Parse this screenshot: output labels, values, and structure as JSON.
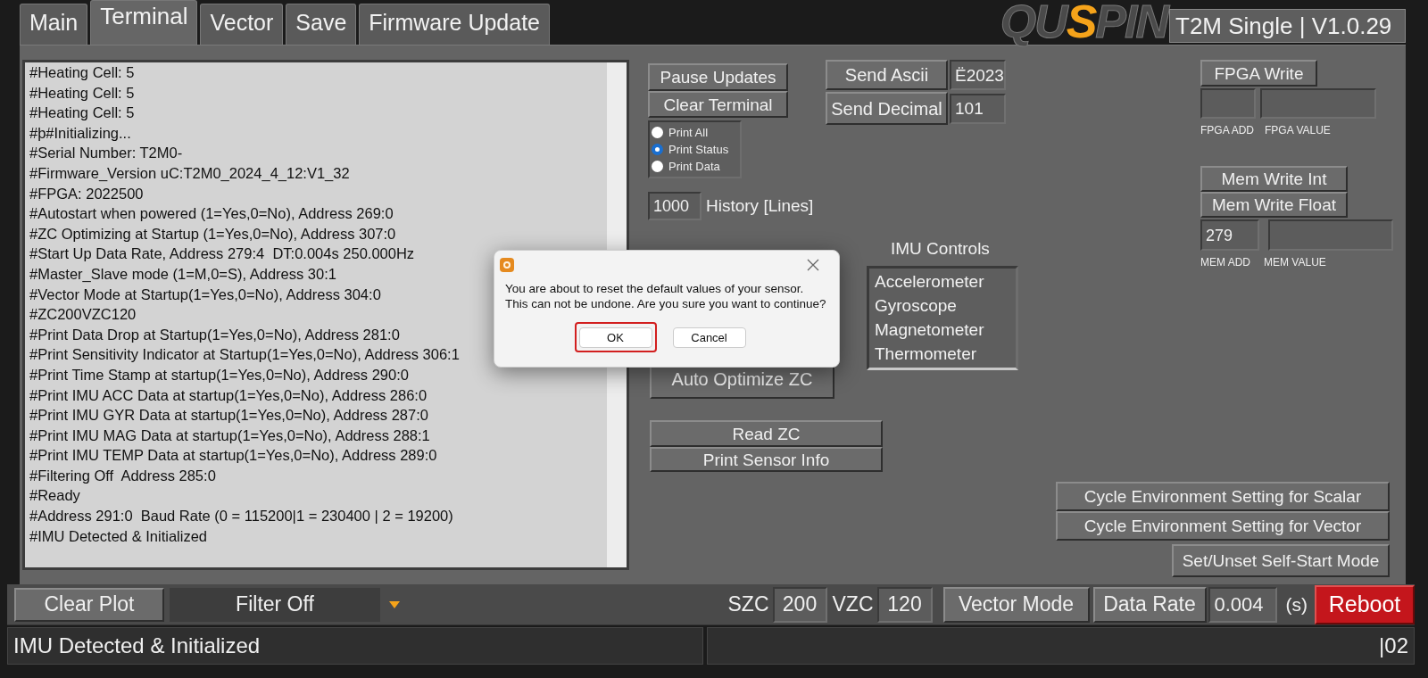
{
  "tabs": [
    {
      "label": "Main",
      "selected": false
    },
    {
      "label": "Terminal",
      "selected": true
    },
    {
      "label": "Vector",
      "selected": false
    },
    {
      "label": "Save",
      "selected": false
    },
    {
      "label": "Firmware Update",
      "selected": false
    }
  ],
  "logo": {
    "parts": [
      {
        "text": "QU",
        "accent": false
      },
      {
        "text": "S",
        "accent": true
      },
      {
        "text": "PIN",
        "accent": false
      }
    ]
  },
  "app_title": "T2M Single | V1.0.29",
  "terminal": {
    "lines": [
      "#Heating Cell: 5",
      "#Heating Cell: 5",
      "#Heating Cell: 5",
      "#þ#Initializing...",
      "#Serial Number: T2M0-",
      "#Firmware_Version uC:T2M0_2024_4_12:V1_32",
      "#FPGA: 2022500",
      "#Autostart when powered (1=Yes,0=No), Address 269:0",
      "#ZC Optimizing at Startup (1=Yes,0=No), Address 307:0",
      "#Start Up Data Rate, Address 279:4  DT:0.004s 250.000Hz",
      "#Master_Slave mode (1=M,0=S), Address 30:1",
      "#Vector Mode at Startup(1=Yes,0=No), Address 304:0",
      "#ZC200VZC120",
      "#Print Data Drop at Startup(1=Yes,0=No), Address 281:0",
      "#Print Sensitivity Indicator at Startup(1=Yes,0=No), Address 306:1",
      "#Print Time Stamp at startup(1=Yes,0=No), Address 290:0",
      "#Print IMU ACC Data at startup(1=Yes,0=No), Address 286:0",
      "#Print IMU GYR Data at startup(1=Yes,0=No), Address 287:0",
      "#Print IMU MAG Data at startup(1=Yes,0=No), Address 288:1",
      "#Print IMU TEMP Data at startup(1=Yes,0=No), Address 289:0",
      "#Filtering Off  Address 285:0",
      "#Ready",
      "#Address 291:0  Baud Rate (0 = 115200|1 = 230400 | 2 = 19200)",
      "#IMU Detected & Initialized"
    ]
  },
  "controls": {
    "pause_button": "Pause Updates",
    "clear_button": "Clear Terminal",
    "print_modes": [
      {
        "label": "Print All",
        "selected": false
      },
      {
        "label": "Print Status",
        "selected": true
      },
      {
        "label": "Print Data",
        "selected": false
      }
    ],
    "history": {
      "value": "1000",
      "label": "History [Lines]"
    },
    "send_ascii": {
      "button": "Send Ascii",
      "value": "Ë2023"
    },
    "send_decimal": {
      "button": "Send Decimal",
      "value": "101"
    },
    "auto_optimize_button": "Auto Optimize ZC",
    "read_zc_button": "Read ZC",
    "print_sensor_info_button": "Print Sensor Info",
    "imu_controls": {
      "title": "IMU Controls",
      "items": [
        "Accelerometer",
        "Gyroscope",
        "Magnetometer",
        "Thermometer"
      ]
    },
    "fpga": {
      "button": "FPGA Write",
      "address_label": "FPGA ADD",
      "value_label": "FPGA VALUE"
    },
    "mem": {
      "int_button": "Mem Write Int",
      "float_button": "Mem Write Float",
      "address_value": "279",
      "address_label": "MEM ADD",
      "value_label": "MEM VALUE"
    },
    "environment_buttons": [
      "Cycle Environment Setting for Scalar",
      "Cycle Environment Setting for Vector",
      "Set/Unset Self-Start Mode"
    ]
  },
  "bottom_bar": {
    "clear_plot": "Clear Plot",
    "filter": "Filter Off",
    "szc": {
      "label": "SZC",
      "value": "200"
    },
    "vzc": {
      "label": "VZC",
      "value": "120"
    },
    "vector_mode": "Vector Mode",
    "data_rate": {
      "label": "Data Rate",
      "value": "0.004",
      "unit": "(s)"
    },
    "reboot": "Reboot"
  },
  "status_bar": {
    "message": "IMU Detected & Initialized",
    "right": "|02"
  },
  "dialog": {
    "message_lines": [
      "You are about to reset the default values of your sensor.",
      "This can not be undone. Are you sure you want to continue?"
    ],
    "buttons": [
      {
        "label": "OK",
        "focused": true
      },
      {
        "label": "Cancel",
        "focused": false
      }
    ]
  }
}
